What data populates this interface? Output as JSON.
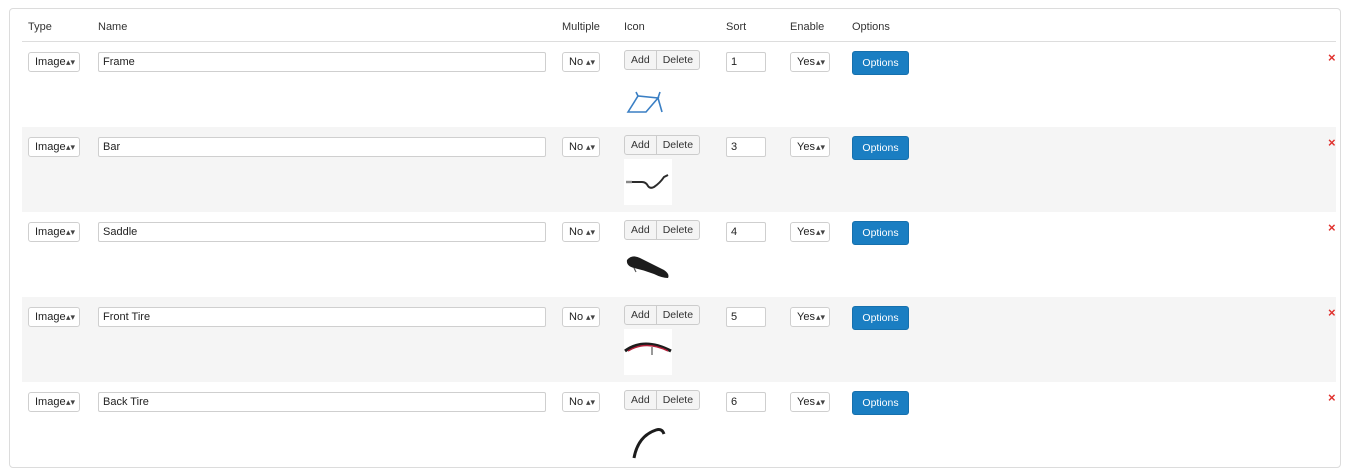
{
  "columns": {
    "type": "Type",
    "name": "Name",
    "multiple": "Multiple",
    "icon": "Icon",
    "sort": "Sort",
    "enable": "Enable",
    "options": "Options"
  },
  "buttons": {
    "add": "Add",
    "delete": "Delete",
    "options": "Options",
    "remove": "×"
  },
  "rows": [
    {
      "type": "Image",
      "name": "Frame",
      "multiple": "No",
      "sort": "1",
      "enable": "Yes",
      "icon": "bike-frame-icon"
    },
    {
      "type": "Image",
      "name": "Bar",
      "multiple": "No",
      "sort": "3",
      "enable": "Yes",
      "icon": "handlebar-icon"
    },
    {
      "type": "Image",
      "name": "Saddle",
      "multiple": "No",
      "sort": "4",
      "enable": "Yes",
      "icon": "saddle-icon"
    },
    {
      "type": "Image",
      "name": "Front Tire",
      "multiple": "No",
      "sort": "5",
      "enable": "Yes",
      "icon": "front-tire-icon"
    },
    {
      "type": "Image",
      "name": "Back Tire",
      "multiple": "No",
      "sort": "6",
      "enable": "Yes",
      "icon": "back-tire-icon"
    }
  ],
  "colors": {
    "options_button": "#1a7ec2",
    "remove": "#e0312d",
    "row_alt": "#f5f5f5"
  }
}
